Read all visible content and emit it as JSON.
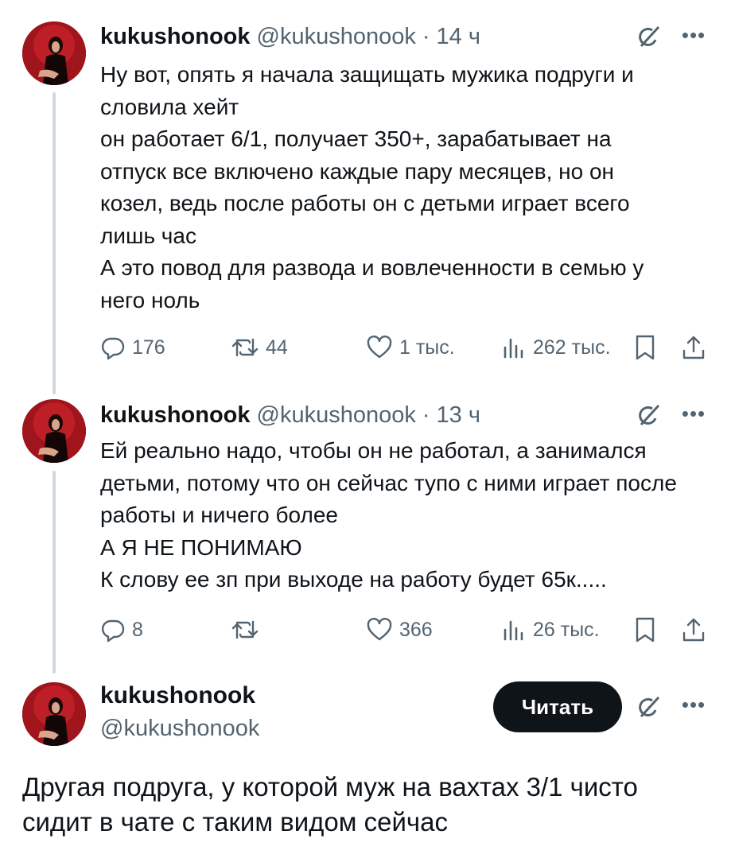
{
  "tweets": [
    {
      "name": "kukushonook",
      "handle": "@kukushonook",
      "separator": "·",
      "time": "14 ч",
      "lines": [
        "Ну вот, опять я начала защищать мужика подруги и",
        "словила хейт",
        "он работает 6/1, получает 350+, зарабатывает на",
        "отпуск все включено каждые пару месяцев, но он",
        "козел, ведь после работы он с детьми играет всего",
        "лишь час",
        "А это повод для развода и вовлеченности в семью у",
        "него ноль"
      ],
      "replies": "176",
      "reposts": "44",
      "likes": "1 тыс.",
      "views": "262 тыс."
    },
    {
      "name": "kukushonook",
      "handle": "@kukushonook",
      "separator": "·",
      "time": "13 ч",
      "lines": [
        "Ей реально надо, чтобы он не работал, а занимался",
        "детьми, потому что он сейчас тупо с ними играет после",
        "работы и ничего более",
        "А Я НЕ ПОНИМАЮ",
        "К слову ее зп при выходе на работу будет 65к....."
      ],
      "replies": "8",
      "reposts": "",
      "likes": "366",
      "views": "26 тыс."
    }
  ],
  "main_tweet": {
    "name": "kukushonook",
    "handle": "@kukushonook",
    "follow_label": "Читать",
    "lines": [
      "Другая подруга, у которой муж на вахтах 3/1 чисто",
      "сидит в чате с таким видом сейчас"
    ]
  },
  "icons": {
    "reply": "reply-icon",
    "repost": "repost-icon",
    "like": "like-icon",
    "views": "views-icon",
    "bookmark": "bookmark-icon",
    "share": "share-icon",
    "grok": "grok-icon",
    "more": "more-icon"
  },
  "colors": {
    "text": "#0f1419",
    "secondary": "#536471",
    "thread_line": "#cfd9de",
    "button_bg": "#0f1419",
    "button_text": "#ffffff"
  }
}
